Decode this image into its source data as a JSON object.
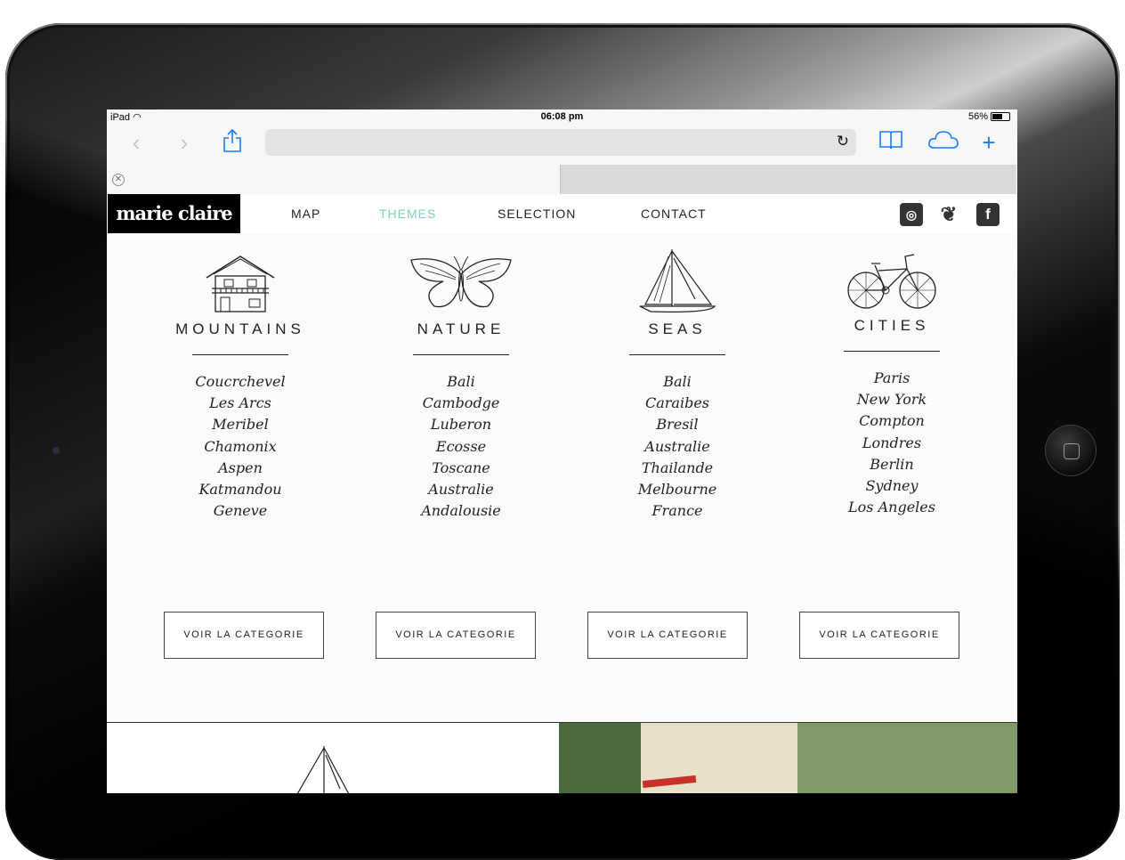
{
  "status": {
    "device": "iPad",
    "time": "06:08 pm",
    "battery": "56%"
  },
  "browser": {
    "url": ""
  },
  "site": {
    "logo": "marie claire",
    "nav": [
      {
        "label": "MAP",
        "active": false
      },
      {
        "label": "THEMES",
        "active": true
      },
      {
        "label": "SELECTION",
        "active": false
      },
      {
        "label": "CONTACT",
        "active": false
      }
    ],
    "social": [
      "instagram-icon",
      "twitter-icon",
      "facebook-icon"
    ],
    "accent_color": "#7fcfc4",
    "categories": [
      {
        "title": "MOUNTAINS",
        "icon": "chalet-icon",
        "places": [
          "Coucrchevel",
          "Les Arcs",
          "Meribel",
          "Chamonix",
          "Aspen",
          "Katmandou",
          "Geneve"
        ],
        "button": "VOIR LA CATEGORIE"
      },
      {
        "title": "NATURE",
        "icon": "butterfly-icon",
        "places": [
          "Bali",
          "Cambodge",
          "Luberon",
          "Ecosse",
          "Toscane",
          "Australie",
          "Andalousie"
        ],
        "button": "VOIR LA CATEGORIE"
      },
      {
        "title": "SEAS",
        "icon": "sailboat-icon",
        "places": [
          "Bali",
          "Caraibes",
          "Bresil",
          "Australie",
          "Thailande",
          "Melbourne",
          "France"
        ],
        "button": "VOIR LA CATEGORIE"
      },
      {
        "title": "CITIES",
        "icon": "bicycle-icon",
        "places": [
          "Paris",
          "New York",
          "Compton",
          "Londres",
          "Berlin",
          "Sydney",
          "Los Angeles"
        ],
        "button": "VOIR LA CATEGORIE"
      }
    ]
  }
}
